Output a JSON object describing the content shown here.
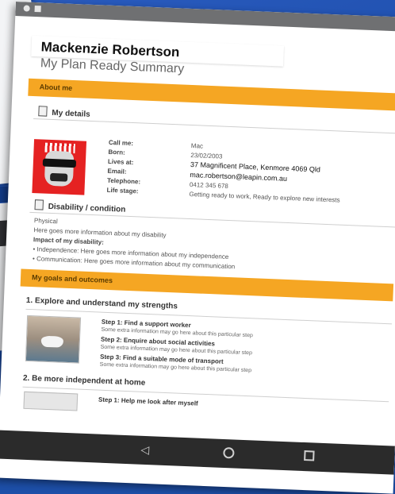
{
  "profile": {
    "name": "Mackenzie Robertson",
    "subtitle": "My Plan Ready Summary"
  },
  "sections": {
    "about_me": "About me",
    "goals": "My goals and outcomes"
  },
  "my_details": {
    "heading": "My details",
    "labels": {
      "call_me": "Call me:",
      "born": "Born:",
      "lives_at": "Lives at:",
      "email": "Email:",
      "telephone": "Telephone:",
      "life_stage": "Life stage:"
    },
    "values": {
      "call_me": "Mac",
      "born": "23/02/2003",
      "lives_at": "37 Magnificent Place, Kenmore 4069 Qld",
      "email": "mac.robertson@leapin.com.au",
      "telephone": "0412 345 678",
      "life_stage": "Getting ready to work, Ready to explore new interests"
    }
  },
  "disability": {
    "heading": "Disability / condition",
    "type": "Physical",
    "info": "Here goes more information about my disability",
    "impact_label": "Impact of my disability:",
    "impact_1": "• Independence: Here goes more information about my independence",
    "impact_2": "• Communication: Here goes more information about my communication"
  },
  "goals": {
    "goal1": {
      "title": "1. Explore and understand my strengths",
      "steps": [
        {
          "title": "Step 1: Find a support worker",
          "note": "Some extra information may go here about this particular step"
        },
        {
          "title": "Step 2: Enquire about social activities",
          "note": "Some extra information may go here about this particular step"
        },
        {
          "title": "Step 3: Find a suitable mode of transport",
          "note": "Some extra information may go here about this particular step"
        }
      ]
    },
    "goal2": {
      "title": "2. Be more independent at home",
      "steps": [
        {
          "title": "Step 1: Help me look after myself"
        }
      ]
    }
  },
  "icons": {
    "details": "id-card-icon",
    "disability": "info-card-icon",
    "nav_back": "back-triangle-icon",
    "nav_home": "home-circle-icon",
    "nav_recent": "recent-square-icon"
  },
  "colors": {
    "section_accent": "#f5a623",
    "avatar_bg": "#e52222",
    "background": "#1d4fa8"
  }
}
